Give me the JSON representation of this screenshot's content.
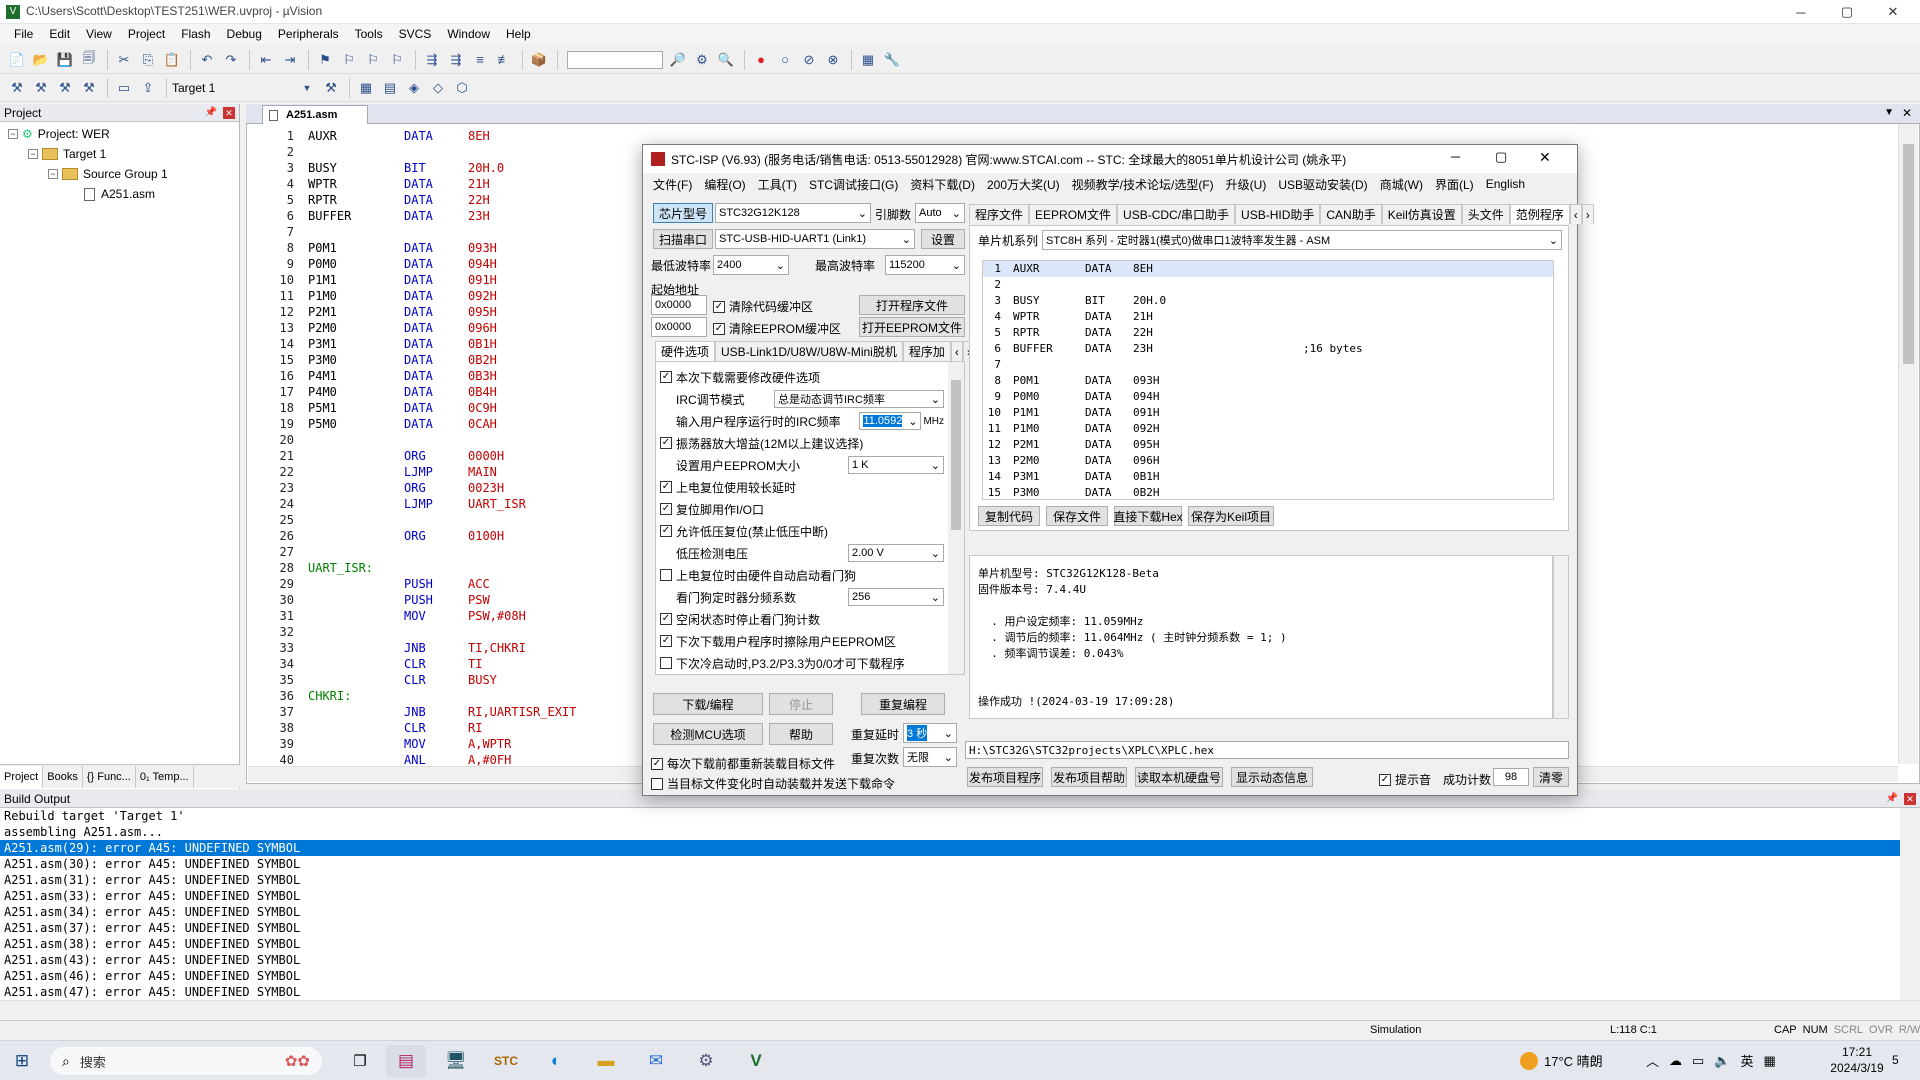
{
  "window": {
    "title": "C:\\Users\\Scott\\Desktop\\TEST251\\WER.uvproj - µVision",
    "min": "─",
    "max": "▢",
    "close": "✕"
  },
  "menu": [
    "File",
    "Edit",
    "View",
    "Project",
    "Flash",
    "Debug",
    "Peripherals",
    "Tools",
    "SVCS",
    "Window",
    "Help"
  ],
  "toolbar1": [
    "📄",
    "📂",
    "💾",
    "🗐",
    "✂",
    "⎘",
    "📋",
    "↶",
    "↷",
    "⇤",
    "⇥",
    "⚑",
    "⚐",
    "⚐",
    "⚐",
    "⇶",
    "⇶",
    "≡",
    "≢",
    "📦",
    "🔎",
    "⚙",
    "🔍",
    "●",
    "○",
    "⊘",
    "⊗",
    "▦",
    "🔧"
  ],
  "toolbar2": [
    "⚒",
    "⚒",
    "⚒",
    "⚒",
    "▭",
    "⇪"
  ],
  "target_select": "Target 1",
  "project": {
    "header": "Project",
    "items": [
      "Project: WER",
      "Target 1",
      "Source Group 1",
      "A251.asm"
    ],
    "tabs": [
      "Project",
      "Books",
      "{} Func...",
      "0₁ Temp..."
    ]
  },
  "editor": {
    "tab": "A251.asm",
    "lines": [
      [
        "1",
        "AUXR",
        "DATA",
        "8EH"
      ],
      [
        "2",
        "",
        "",
        ""
      ],
      [
        "3",
        "BUSY",
        "BIT",
        "20H.0"
      ],
      [
        "4",
        "WPTR",
        "DATA",
        "21H"
      ],
      [
        "5",
        "RPTR",
        "DATA",
        "22H"
      ],
      [
        "6",
        "BUFFER",
        "DATA",
        "23H"
      ],
      [
        "7",
        "",
        "",
        ""
      ],
      [
        "8",
        "P0M1",
        "DATA",
        "093H"
      ],
      [
        "9",
        "P0M0",
        "DATA",
        "094H"
      ],
      [
        "10",
        "P1M1",
        "DATA",
        "091H"
      ],
      [
        "11",
        "P1M0",
        "DATA",
        "092H"
      ],
      [
        "12",
        "P2M1",
        "DATA",
        "095H"
      ],
      [
        "13",
        "P2M0",
        "DATA",
        "096H"
      ],
      [
        "14",
        "P3M1",
        "DATA",
        "0B1H"
      ],
      [
        "15",
        "P3M0",
        "DATA",
        "0B2H"
      ],
      [
        "16",
        "P4M1",
        "DATA",
        "0B3H"
      ],
      [
        "17",
        "P4M0",
        "DATA",
        "0B4H"
      ],
      [
        "18",
        "P5M1",
        "DATA",
        "0C9H"
      ],
      [
        "19",
        "P5M0",
        "DATA",
        "0CAH"
      ],
      [
        "20",
        "",
        "",
        ""
      ],
      [
        "21",
        "",
        "ORG",
        "0000H"
      ],
      [
        "22",
        "",
        "LJMP",
        "MAIN"
      ],
      [
        "23",
        "",
        "ORG",
        "0023H"
      ],
      [
        "24",
        "",
        "LJMP",
        "UART_ISR"
      ],
      [
        "25",
        "",
        "",
        ""
      ],
      [
        "26",
        "",
        "ORG",
        "0100H"
      ],
      [
        "27",
        "",
        "",
        ""
      ],
      [
        "28",
        "UART_ISR:",
        "",
        ""
      ],
      [
        "29",
        "",
        "PUSH",
        "ACC"
      ],
      [
        "30",
        "",
        "PUSH",
        "PSW"
      ],
      [
        "31",
        "",
        "MOV",
        "PSW,#08H"
      ],
      [
        "32",
        "",
        "",
        ""
      ],
      [
        "33",
        "",
        "JNB",
        "TI,CHKRI"
      ],
      [
        "34",
        "",
        "CLR",
        "TI"
      ],
      [
        "35",
        "",
        "CLR",
        "BUSY"
      ],
      [
        "36",
        "CHKRI:",
        "",
        ""
      ],
      [
        "37",
        "",
        "JNB",
        "RI,UARTISR_EXIT"
      ],
      [
        "38",
        "",
        "CLR",
        "RI"
      ],
      [
        "39",
        "",
        "MOV",
        "A,WPTR"
      ],
      [
        "40",
        "",
        "ANL",
        "A,#0FH"
      ]
    ]
  },
  "build": {
    "header": "Build Output",
    "lines": [
      "Rebuild target 'Target 1'",
      "assembling A251.asm...",
      "A251.asm(29): error A45: UNDEFINED SYMBOL",
      "A251.asm(30): error A45: UNDEFINED SYMBOL",
      "A251.asm(31): error A45: UNDEFINED SYMBOL",
      "A251.asm(33): error A45: UNDEFINED SYMBOL",
      "A251.asm(34): error A45: UNDEFINED SYMBOL",
      "A251.asm(37): error A45: UNDEFINED SYMBOL",
      "A251.asm(38): error A45: UNDEFINED SYMBOL",
      "A251.asm(43): error A45: UNDEFINED SYMBOL",
      "A251.asm(46): error A45: UNDEFINED SYMBOL",
      "A251.asm(47): error A45: UNDEFINED SYMBOL"
    ],
    "selected": 2
  },
  "status": {
    "sim": "Simulation",
    "pos": "L:118 C:1",
    "flags": [
      "CAP",
      "NUM",
      "SCRL",
      "OVR",
      "R/W"
    ]
  },
  "isp": {
    "title": "STC-ISP (V6.93) (服务电话/销售电话: 0513-55012928) 官网:www.STCAI.com  -- STC: 全球最大的8051单片机设计公司 (姚永平)",
    "menu": [
      "文件(F)",
      "编程(O)",
      "工具(T)",
      "STC调试接口(G)",
      "资料下载(D)",
      "200万大奖(U)",
      "视频教学/技术论坛/选型(F)",
      "升级(U)",
      "USB驱动安装(D)",
      "商城(W)",
      "界面(L)",
      "English"
    ],
    "chip_label": "芯片型号",
    "chip": "STC32G12K128",
    "pin_label": "引脚数",
    "pin": "Auto",
    "scan_label": "扫描串口",
    "port": "STC-USB-HID-UART1 (Link1)",
    "settings": "设置",
    "min_baud_label": "最低波特率",
    "min_baud": "2400",
    "max_baud_label": "最高波特率",
    "max_baud": "115200",
    "start_label": "起始地址",
    "addr1": "0x0000",
    "clear_code": "清除代码缓冲区",
    "open_prog": "打开程序文件",
    "addr2": "0x0000",
    "clear_eeprom": "清除EEPROM缓冲区",
    "open_eeprom": "打开EEPROM文件",
    "tabs_left": [
      "硬件选项",
      "USB-Link1D/U8W/U8W-Mini脱机",
      "程序加"
    ],
    "opts": [
      {
        "t": "本次下载需要修改硬件选项",
        "c": true
      },
      {
        "t": "IRC调节模式",
        "sel": "总是动态调节IRC频率"
      },
      {
        "t": "输入用户程序运行时的IRC频率",
        "sel": "11.0592",
        "unit": "MHz"
      },
      {
        "t": "振荡器放大增益(12M以上建议选择)",
        "c": true
      },
      {
        "t": "设置用户EEPROM大小",
        "sel": "1   K"
      },
      {
        "t": "上电复位使用较长延时",
        "c": true
      },
      {
        "t": "复位脚用作I/O口",
        "c": true
      },
      {
        "t": "允许低压复位(禁止低压中断)",
        "c": true
      },
      {
        "t": "低压检测电压",
        "sel": "2.00 V"
      },
      {
        "t": "上电复位时由硬件自动启动看门狗",
        "c": false
      },
      {
        "t": "看门狗定时器分频系数",
        "sel": "256"
      },
      {
        "t": "空闲状态时停止看门狗计数",
        "c": true
      },
      {
        "t": "下次下载用户程序时擦除用户EEPROM区",
        "c": true
      },
      {
        "t": "下次冷启动时,P3.2/P3.3为0/0才可下载程序",
        "c": false
      }
    ],
    "download": "下载/编程",
    "stop": "停止",
    "reprogram": "重复编程",
    "check_mcu": "检测MCU选项",
    "help": "帮助",
    "delay_label": "重复延时",
    "delay": "3 秒",
    "count_label": "重复次数",
    "count": "无限",
    "reload": "每次下载前都重新装载目标文件",
    "autosend": "当目标文件变化时自动装载并发送下载命令",
    "tabs_right": [
      "程序文件",
      "EEPROM文件",
      "USB-CDC/串口助手",
      "USB-HID助手",
      "CAN助手",
      "Keil仿真设置",
      "头文件",
      "范例程序"
    ],
    "series_label": "单片机系列",
    "series": "STC8H 系列 - 定时器1(模式0)做串口1波特率发生器 - ASM",
    "sample": [
      [
        "1",
        "AUXR",
        "DATA",
        "8EH",
        ""
      ],
      [
        "2",
        "",
        "",
        "",
        ""
      ],
      [
        "3",
        "BUSY",
        "BIT",
        "20H.0",
        ""
      ],
      [
        "4",
        "WPTR",
        "DATA",
        "21H",
        ""
      ],
      [
        "5",
        "RPTR",
        "DATA",
        "22H",
        ""
      ],
      [
        "6",
        "BUFFER",
        "DATA",
        "23H",
        ";16 bytes"
      ],
      [
        "7",
        "",
        "",
        "",
        ""
      ],
      [
        "8",
        "P0M1",
        "DATA",
        "093H",
        ""
      ],
      [
        "9",
        "P0M0",
        "DATA",
        "094H",
        ""
      ],
      [
        "10",
        "P1M1",
        "DATA",
        "091H",
        ""
      ],
      [
        "11",
        "P1M0",
        "DATA",
        "092H",
        ""
      ],
      [
        "12",
        "P2M1",
        "DATA",
        "095H",
        ""
      ],
      [
        "13",
        "P2M0",
        "DATA",
        "096H",
        ""
      ],
      [
        "14",
        "P3M1",
        "DATA",
        "0B1H",
        ""
      ],
      [
        "15",
        "P3M0",
        "DATA",
        "0B2H",
        ""
      ]
    ],
    "copy": "复制代码",
    "save": "保存文件",
    "direct": "直接下载Hex",
    "savekeil": "保存为Keil项目",
    "log": [
      "单片机型号: STC32G12K128-Beta",
      "固件版本号: 7.4.4U",
      "",
      "  . 用户设定频率: 11.059MHz",
      "  . 调节后的频率: 11.064MHz ( 主时钟分频系数 = 1; )",
      "  . 频率调节误差: 0.043%",
      "",
      "",
      "操作成功 !(2024-03-19 17:09:28)"
    ],
    "hexpath": "H:\\STC32G\\STC32projects\\XPLC\\XPLC.hex",
    "publish": "发布项目程序",
    "publish_help": "发布项目帮助",
    "read_disk": "读取本机硬盘号",
    "show_dyn": "显示动态信息",
    "sound": "提示音",
    "success_label": "成功计数",
    "success": "98",
    "clear": "清零"
  },
  "taskbar": {
    "search": "搜索",
    "weather": "17°C 晴朗",
    "time": "17:21",
    "date": "2024/3/19",
    "ime": "英",
    "notif": "5"
  }
}
